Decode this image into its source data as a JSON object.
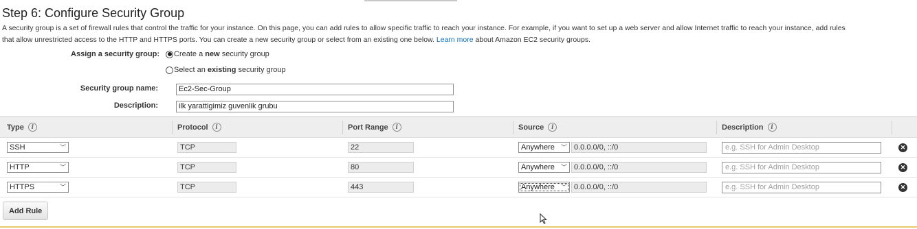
{
  "page": {
    "title": "Step 6: Configure Security Group",
    "intro_line1": "A security group is a set of firewall rules that control the traffic for your instance. On this page, you can add rules to allow specific traffic to reach your instance. For example, if you want to set up a web server and allow Internet traffic to reach your instance, add rules",
    "intro_line2_pre": "that allow unrestricted access to the HTTP and HTTPS ports. You can create a new security group or select from an existing one below.",
    "learn_more": "Learn more",
    "intro_line2_post": "about Amazon EC2 security groups."
  },
  "assign": {
    "label": "Assign a security group:",
    "option_new_pre": "Create a ",
    "option_new_bold": "new",
    "option_new_post": " security group",
    "option_existing_pre": "Select an ",
    "option_existing_bold": "existing",
    "option_existing_post": " security group",
    "selected": "new"
  },
  "group": {
    "name_label": "Security group name:",
    "name_value": "Ec2-Sec-Group",
    "description_label": "Description:",
    "description_value": "ilk yarattigimiz guvenlik grubu"
  },
  "table": {
    "headers": {
      "type": "Type",
      "protocol": "Protocol",
      "port_range": "Port Range",
      "source": "Source",
      "description": "Description"
    },
    "rows": [
      {
        "type": "SSH",
        "protocol": "TCP",
        "port": "22",
        "source": "Anywhere",
        "cidr": "0.0.0.0/0, ::/0",
        "desc_placeholder": "e.g. SSH for Admin Desktop"
      },
      {
        "type": "HTTP",
        "protocol": "TCP",
        "port": "80",
        "source": "Anywhere",
        "cidr": "0.0.0.0/0, ::/0",
        "desc_placeholder": "e.g. SSH for Admin Desktop"
      },
      {
        "type": "HTTPS",
        "protocol": "TCP",
        "port": "443",
        "source": "Anywhere",
        "cidr": "0.0.0.0/0, ::/0",
        "desc_placeholder": "e.g. SSH for Admin Desktop"
      }
    ]
  },
  "actions": {
    "add_rule": "Add Rule"
  },
  "icons": {
    "info": "info-icon",
    "remove": "remove-rule-icon",
    "chevron": "chevron-down-icon",
    "cursor": "mouse-pointer-icon"
  },
  "colors": {
    "link": "#0a6ebd",
    "header_bg": "#eeeeee",
    "readonly_bg": "#ececec",
    "warning_line": "#e9c86a"
  }
}
